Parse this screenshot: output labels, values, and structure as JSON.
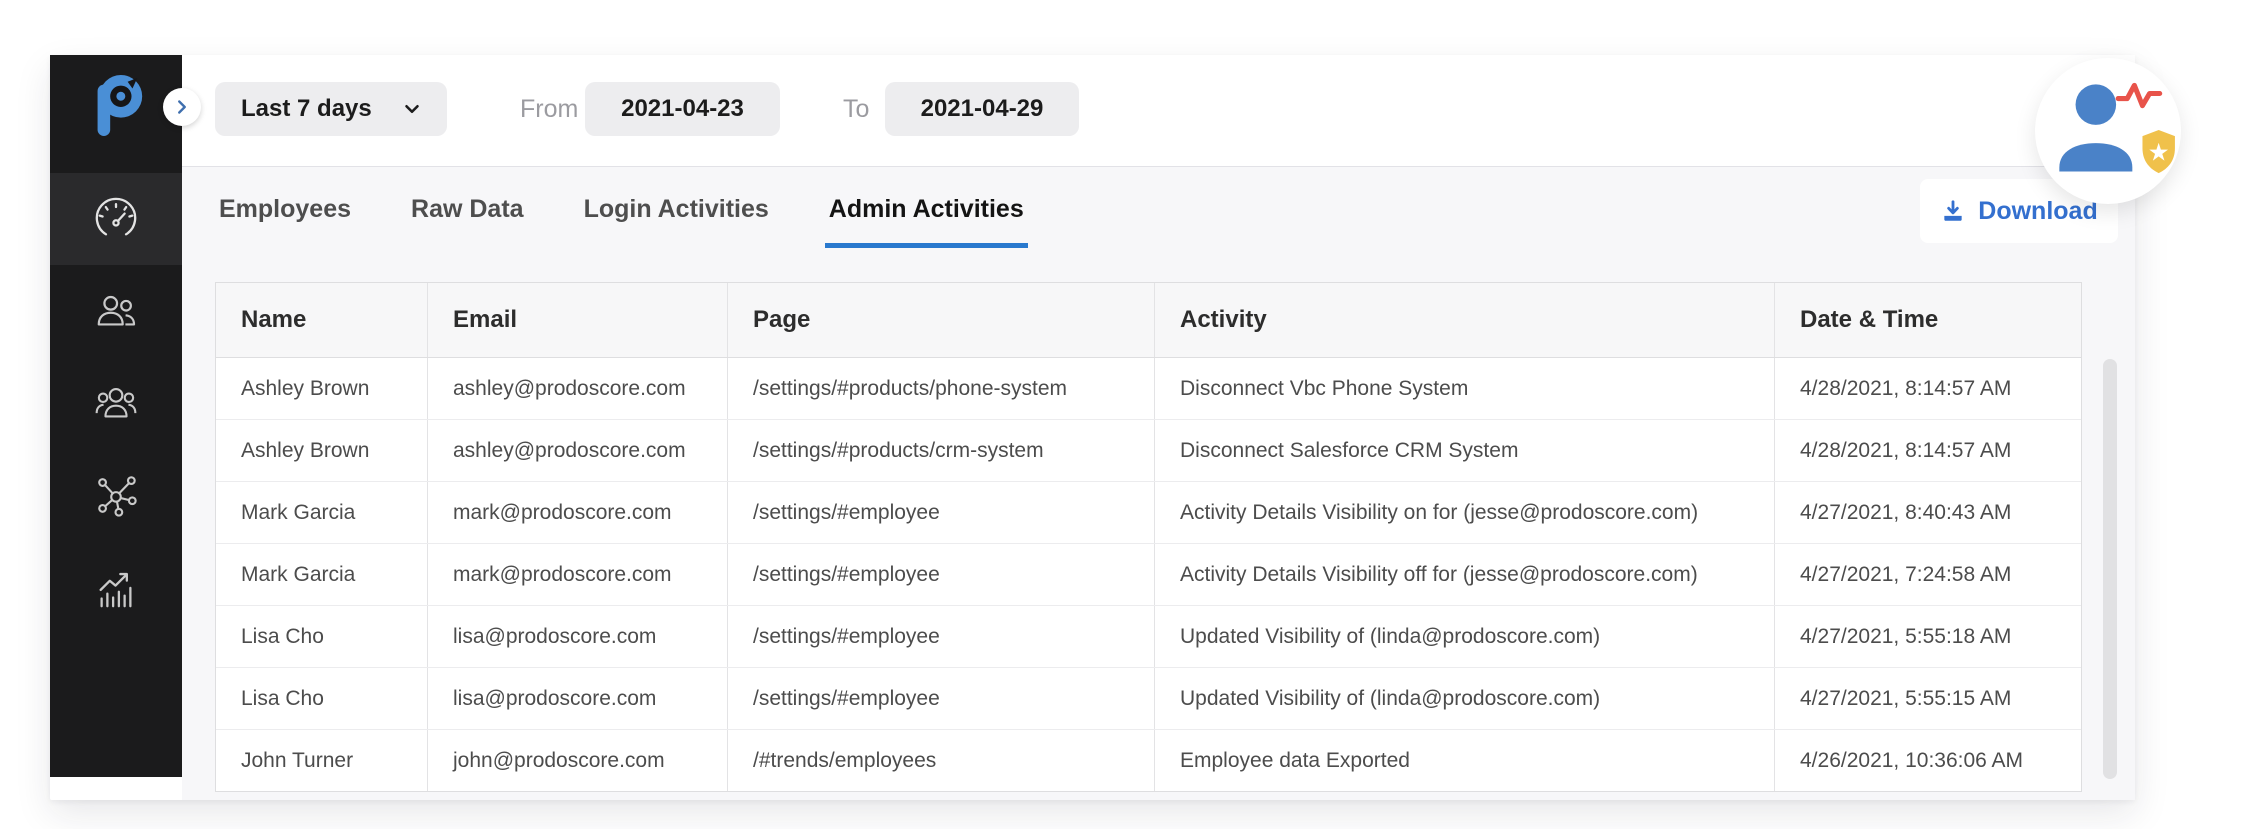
{
  "filter_bar": {
    "range_selector": "Last 7 days",
    "from_label": "From",
    "from_date": "2021-04-23",
    "to_label": "To",
    "to_date": "2021-04-29"
  },
  "tabs": [
    {
      "label": "Employees",
      "active": false
    },
    {
      "label": "Raw Data",
      "active": false
    },
    {
      "label": "Login Activities",
      "active": false
    },
    {
      "label": "Admin Activities",
      "active": true
    }
  ],
  "toolbar": {
    "download_label": "Download"
  },
  "sidebar": {
    "items": [
      {
        "icon": "speedometer-icon",
        "active": true
      },
      {
        "icon": "employees-icon",
        "active": false
      },
      {
        "icon": "team-icon",
        "active": false
      },
      {
        "icon": "integrations-icon",
        "active": false
      },
      {
        "icon": "trends-icon",
        "active": false
      }
    ]
  },
  "table": {
    "columns": [
      "Name",
      "Email",
      "Page",
      "Activity",
      "Date & Time"
    ],
    "rows": [
      [
        "Ashley Brown",
        "ashley@prodoscore.com",
        "/settings/#products/phone-system",
        "Disconnect Vbc Phone System",
        "4/28/2021, 8:14:57 AM"
      ],
      [
        "Ashley Brown",
        "ashley@prodoscore.com",
        "/settings/#products/crm-system",
        "Disconnect Salesforce CRM System",
        "4/28/2021, 8:14:57 AM"
      ],
      [
        "Mark Garcia",
        "mark@prodoscore.com",
        "/settings/#employee",
        "Activity Details Visibility on for (jesse@prodoscore.com)",
        "4/27/2021, 8:40:43 AM"
      ],
      [
        "Mark Garcia",
        "mark@prodoscore.com",
        "/settings/#employee",
        "Activity Details Visibility off for (jesse@prodoscore.com)",
        "4/27/2021, 7:24:58 AM"
      ],
      [
        "Lisa Cho",
        "lisa@prodoscore.com",
        "/settings/#employee",
        "Updated Visibility of (linda@prodoscore.com)",
        "4/27/2021, 5:55:18 AM"
      ],
      [
        "Lisa Cho",
        "lisa@prodoscore.com",
        "/settings/#employee",
        "Updated Visibility of (linda@prodoscore.com)",
        "4/27/2021, 5:55:15 AM"
      ],
      [
        "John Turner",
        "john@prodoscore.com",
        "/#trends/employees",
        "Employee data Exported",
        "4/26/2021, 10:36:06 AM"
      ]
    ]
  },
  "colors": {
    "accent_blue": "#2979ce",
    "logo_blue": "#4a8fd6",
    "download_blue": "#3470cf",
    "sidebar_bg": "#1b1b1c",
    "panel_bg": "#f7f7f9",
    "pulse_red": "#e8534a",
    "shield_yellow": "#f0c14b"
  }
}
